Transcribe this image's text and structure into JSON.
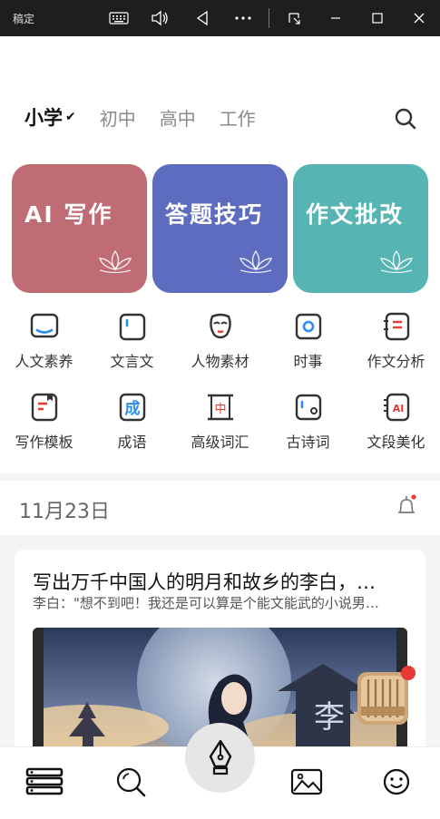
{
  "titlebar": {
    "app_name": "稿定",
    "icons": [
      "keyboard-icon",
      "volume-icon",
      "back-icon",
      "more-icon",
      "window-icon",
      "minimize-icon",
      "maximize-icon",
      "close-icon"
    ]
  },
  "grade_tabs": [
    {
      "label": "小学",
      "active": true
    },
    {
      "label": "初中",
      "active": false
    },
    {
      "label": "高中",
      "active": false
    },
    {
      "label": "工作",
      "active": false
    }
  ],
  "feature_cards": [
    {
      "label": "AI 写作",
      "color": "#c06c74"
    },
    {
      "label": "答题技巧",
      "color": "#5e6cbf"
    },
    {
      "label": "作文批改",
      "color": "#56b4b2"
    }
  ],
  "grid": [
    {
      "label": "人文素养",
      "icon": "book-icon"
    },
    {
      "label": "文言文",
      "icon": "document-icon"
    },
    {
      "label": "人物素材",
      "icon": "opera-mask-icon"
    },
    {
      "label": "时事",
      "icon": "camera-icon"
    },
    {
      "label": "作文分析",
      "icon": "notebook-icon"
    },
    {
      "label": "写作模板",
      "icon": "template-icon"
    },
    {
      "label": "成语",
      "icon": "idiom-icon"
    },
    {
      "label": "高级词汇",
      "icon": "vocab-icon"
    },
    {
      "label": "古诗词",
      "icon": "poem-icon"
    },
    {
      "label": "文段美化",
      "icon": "ai-notebook-icon"
    }
  ],
  "date": "11月23日",
  "article": {
    "title": "写出万千中国人的明月和故乡的李白，…",
    "subtitle": "李白：\"想不到吧！我还是可以算是个能文能武的小说男…"
  },
  "bottom_nav": [
    "library-icon",
    "explore-icon",
    "pen-icon",
    "gallery-icon",
    "smile-icon"
  ],
  "colors": {
    "accent_red": "#e63a32"
  }
}
